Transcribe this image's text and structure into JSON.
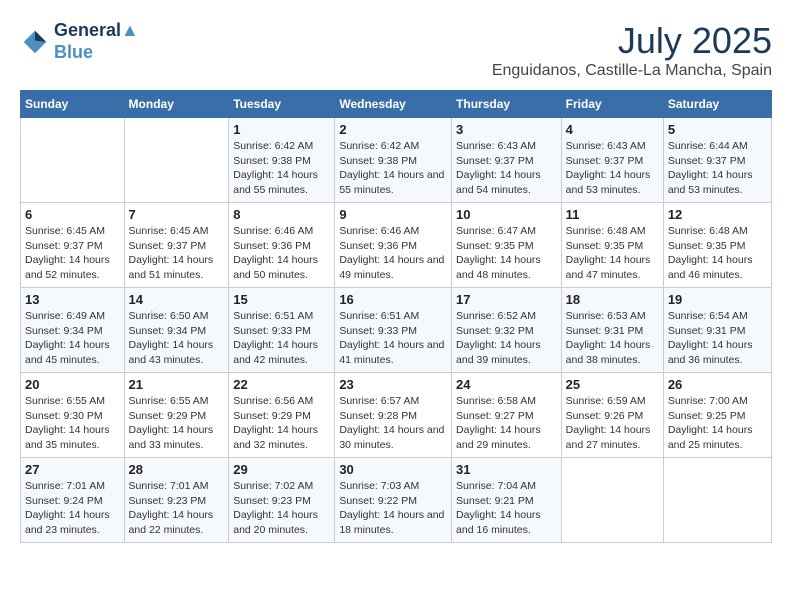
{
  "header": {
    "logo_line1": "General",
    "logo_line2": "Blue",
    "title": "July 2025",
    "subtitle": "Enguidanos, Castille-La Mancha, Spain"
  },
  "calendar": {
    "headers": [
      "Sunday",
      "Monday",
      "Tuesday",
      "Wednesday",
      "Thursday",
      "Friday",
      "Saturday"
    ],
    "weeks": [
      [
        {
          "day": "",
          "info": ""
        },
        {
          "day": "",
          "info": ""
        },
        {
          "day": "1",
          "info": "Sunrise: 6:42 AM\nSunset: 9:38 PM\nDaylight: 14 hours and 55 minutes."
        },
        {
          "day": "2",
          "info": "Sunrise: 6:42 AM\nSunset: 9:38 PM\nDaylight: 14 hours and 55 minutes."
        },
        {
          "day": "3",
          "info": "Sunrise: 6:43 AM\nSunset: 9:37 PM\nDaylight: 14 hours and 54 minutes."
        },
        {
          "day": "4",
          "info": "Sunrise: 6:43 AM\nSunset: 9:37 PM\nDaylight: 14 hours and 53 minutes."
        },
        {
          "day": "5",
          "info": "Sunrise: 6:44 AM\nSunset: 9:37 PM\nDaylight: 14 hours and 53 minutes."
        }
      ],
      [
        {
          "day": "6",
          "info": "Sunrise: 6:45 AM\nSunset: 9:37 PM\nDaylight: 14 hours and 52 minutes."
        },
        {
          "day": "7",
          "info": "Sunrise: 6:45 AM\nSunset: 9:37 PM\nDaylight: 14 hours and 51 minutes."
        },
        {
          "day": "8",
          "info": "Sunrise: 6:46 AM\nSunset: 9:36 PM\nDaylight: 14 hours and 50 minutes."
        },
        {
          "day": "9",
          "info": "Sunrise: 6:46 AM\nSunset: 9:36 PM\nDaylight: 14 hours and 49 minutes."
        },
        {
          "day": "10",
          "info": "Sunrise: 6:47 AM\nSunset: 9:35 PM\nDaylight: 14 hours and 48 minutes."
        },
        {
          "day": "11",
          "info": "Sunrise: 6:48 AM\nSunset: 9:35 PM\nDaylight: 14 hours and 47 minutes."
        },
        {
          "day": "12",
          "info": "Sunrise: 6:48 AM\nSunset: 9:35 PM\nDaylight: 14 hours and 46 minutes."
        }
      ],
      [
        {
          "day": "13",
          "info": "Sunrise: 6:49 AM\nSunset: 9:34 PM\nDaylight: 14 hours and 45 minutes."
        },
        {
          "day": "14",
          "info": "Sunrise: 6:50 AM\nSunset: 9:34 PM\nDaylight: 14 hours and 43 minutes."
        },
        {
          "day": "15",
          "info": "Sunrise: 6:51 AM\nSunset: 9:33 PM\nDaylight: 14 hours and 42 minutes."
        },
        {
          "day": "16",
          "info": "Sunrise: 6:51 AM\nSunset: 9:33 PM\nDaylight: 14 hours and 41 minutes."
        },
        {
          "day": "17",
          "info": "Sunrise: 6:52 AM\nSunset: 9:32 PM\nDaylight: 14 hours and 39 minutes."
        },
        {
          "day": "18",
          "info": "Sunrise: 6:53 AM\nSunset: 9:31 PM\nDaylight: 14 hours and 38 minutes."
        },
        {
          "day": "19",
          "info": "Sunrise: 6:54 AM\nSunset: 9:31 PM\nDaylight: 14 hours and 36 minutes."
        }
      ],
      [
        {
          "day": "20",
          "info": "Sunrise: 6:55 AM\nSunset: 9:30 PM\nDaylight: 14 hours and 35 minutes."
        },
        {
          "day": "21",
          "info": "Sunrise: 6:55 AM\nSunset: 9:29 PM\nDaylight: 14 hours and 33 minutes."
        },
        {
          "day": "22",
          "info": "Sunrise: 6:56 AM\nSunset: 9:29 PM\nDaylight: 14 hours and 32 minutes."
        },
        {
          "day": "23",
          "info": "Sunrise: 6:57 AM\nSunset: 9:28 PM\nDaylight: 14 hours and 30 minutes."
        },
        {
          "day": "24",
          "info": "Sunrise: 6:58 AM\nSunset: 9:27 PM\nDaylight: 14 hours and 29 minutes."
        },
        {
          "day": "25",
          "info": "Sunrise: 6:59 AM\nSunset: 9:26 PM\nDaylight: 14 hours and 27 minutes."
        },
        {
          "day": "26",
          "info": "Sunrise: 7:00 AM\nSunset: 9:25 PM\nDaylight: 14 hours and 25 minutes."
        }
      ],
      [
        {
          "day": "27",
          "info": "Sunrise: 7:01 AM\nSunset: 9:24 PM\nDaylight: 14 hours and 23 minutes."
        },
        {
          "day": "28",
          "info": "Sunrise: 7:01 AM\nSunset: 9:23 PM\nDaylight: 14 hours and 22 minutes."
        },
        {
          "day": "29",
          "info": "Sunrise: 7:02 AM\nSunset: 9:23 PM\nDaylight: 14 hours and 20 minutes."
        },
        {
          "day": "30",
          "info": "Sunrise: 7:03 AM\nSunset: 9:22 PM\nDaylight: 14 hours and 18 minutes."
        },
        {
          "day": "31",
          "info": "Sunrise: 7:04 AM\nSunset: 9:21 PM\nDaylight: 14 hours and 16 minutes."
        },
        {
          "day": "",
          "info": ""
        },
        {
          "day": "",
          "info": ""
        }
      ]
    ]
  }
}
